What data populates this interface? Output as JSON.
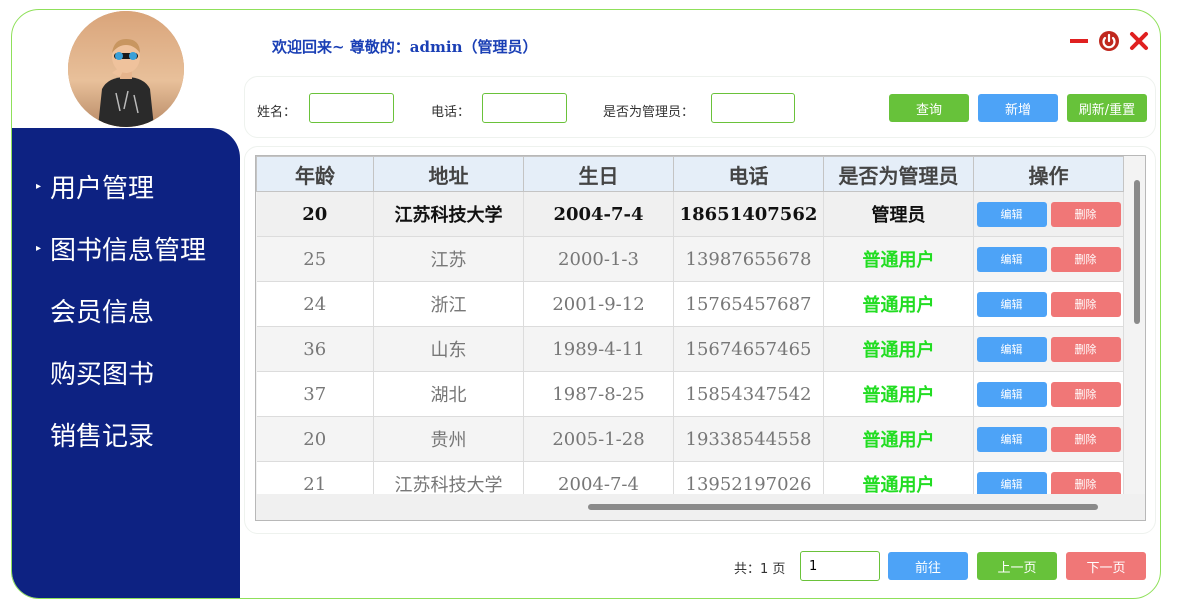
{
  "header": {
    "welcome": "欢迎回来~ 尊敬的：admin（管理员）"
  },
  "sidebar": {
    "items": [
      {
        "label": "用户管理",
        "caret": true
      },
      {
        "label": "图书信息管理",
        "caret": true
      },
      {
        "label": "会员信息",
        "caret": false
      },
      {
        "label": "购买图书",
        "caret": false
      },
      {
        "label": "销售记录",
        "caret": false
      }
    ]
  },
  "search": {
    "name_label": "姓名：",
    "name_value": "",
    "phone_label": "电话：",
    "phone_value": "",
    "admin_label": "是否为管理员：",
    "admin_value": "",
    "query_btn": "查询",
    "add_btn": "新增",
    "refresh_btn": "刷新/重置"
  },
  "table": {
    "headers": [
      "年龄",
      "地址",
      "生日",
      "电话",
      "是否为管理员",
      "操作"
    ],
    "edit_label": "编辑",
    "delete_label": "删除",
    "rows": [
      {
        "age": "20",
        "address": "江苏科技大学",
        "birthday": "2004-7-4",
        "phone": "18651407562",
        "role": "管理员"
      },
      {
        "age": "25",
        "address": "江苏",
        "birthday": "2000-1-3",
        "phone": "13987655678",
        "role": "普通用户"
      },
      {
        "age": "24",
        "address": "浙江",
        "birthday": "2001-9-12",
        "phone": "15765457687",
        "role": "普通用户"
      },
      {
        "age": "36",
        "address": "山东",
        "birthday": "1989-4-11",
        "phone": "15674657465",
        "role": "普通用户"
      },
      {
        "age": "37",
        "address": "湖北",
        "birthday": "1987-8-25",
        "phone": "15854347542",
        "role": "普通用户"
      },
      {
        "age": "20",
        "address": "贵州",
        "birthday": "2005-1-28",
        "phone": "19338544558",
        "role": "普通用户"
      },
      {
        "age": "21",
        "address": "江苏科技大学",
        "birthday": "2004-7-4",
        "phone": "13952197026",
        "role": "普通用户"
      }
    ]
  },
  "pager": {
    "total_text": "共：1 页",
    "page_value": "1",
    "go_btn": "前往",
    "prev_btn": "上一页",
    "next_btn": "下一页"
  },
  "colors": {
    "sidebar_bg": "#0d2282",
    "border_green": "#8fe05a",
    "button_green": "#67c23a",
    "button_blue": "#4da3f7",
    "button_red": "#f07777",
    "role_green": "#22dd22"
  }
}
